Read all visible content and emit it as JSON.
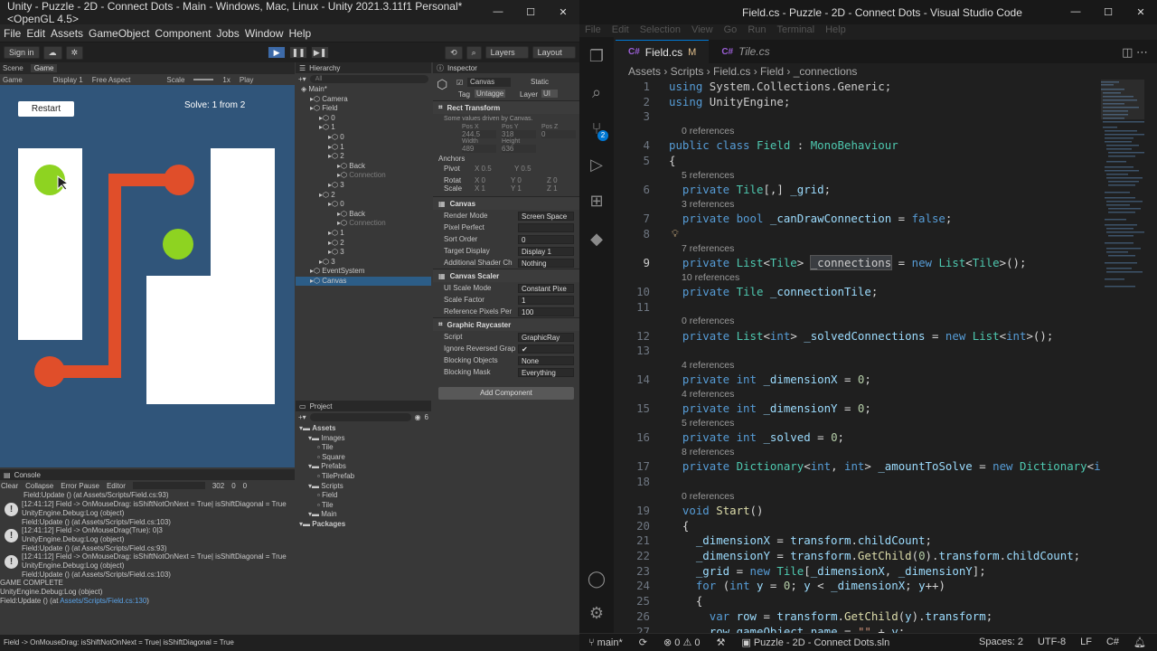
{
  "unity": {
    "title": "Unity - Puzzle - 2D - Connect Dots - Main - Windows, Mac, Linux - Unity 2021.3.11f1 Personal* <OpenGL 4.5>",
    "menu": [
      "File",
      "Edit",
      "Assets",
      "GameObject",
      "Component",
      "Jobs",
      "Window",
      "Help"
    ],
    "toolbar": {
      "sign_in": "Sign in",
      "layers": "Layers",
      "layout": "Layout"
    },
    "game_tabs": {
      "scene": "Scene",
      "game": "Game"
    },
    "game_bar": {
      "mode": "Game",
      "display": "Display 1",
      "aspect": "Free Aspect",
      "scale_label": "Scale",
      "scale_value": "1x",
      "play_label": "Play"
    },
    "game": {
      "restart": "Restart",
      "solve_text": "Solve: 1 from 2",
      "colors": {
        "bg": "#30557a",
        "white": "#ffffff",
        "line": "#e04e2a",
        "green": "#8ed321"
      }
    },
    "hierarchy": {
      "title": "Hierarchy",
      "search_placeholder": "All",
      "items": [
        {
          "label": "Main*",
          "depth": 0
        },
        {
          "label": "Camera",
          "depth": 1
        },
        {
          "label": "Field",
          "depth": 1
        },
        {
          "label": "0",
          "depth": 2
        },
        {
          "label": "1",
          "depth": 2
        },
        {
          "label": "0",
          "depth": 3
        },
        {
          "label": "1",
          "depth": 3
        },
        {
          "label": "2",
          "depth": 3
        },
        {
          "label": "Back",
          "depth": 4
        },
        {
          "label": "Connection",
          "depth": 4,
          "dim": true
        },
        {
          "label": "3",
          "depth": 3
        },
        {
          "label": "2",
          "depth": 2
        },
        {
          "label": "0",
          "depth": 3
        },
        {
          "label": "Back",
          "depth": 4
        },
        {
          "label": "Connection",
          "depth": 4,
          "dim": true
        },
        {
          "label": "1",
          "depth": 3
        },
        {
          "label": "2",
          "depth": 3
        },
        {
          "label": "3",
          "depth": 3
        },
        {
          "label": "3",
          "depth": 2
        },
        {
          "label": "EventSystem",
          "depth": 1
        },
        {
          "label": "Canvas",
          "depth": 1,
          "selected": true
        }
      ]
    },
    "inspector": {
      "title": "Inspector",
      "object_name": "Canvas",
      "static_label": "Static",
      "tag_label": "Tag",
      "tag_value": "Untagge",
      "layer_label": "Layer",
      "layer_value": "UI",
      "rect_transform": {
        "title": "Rect Transform",
        "note": "Some values driven by Canvas.",
        "posx_label": "Pos X",
        "posy_label": "Pos Y",
        "posz_label": "Pos Z",
        "posx": "244.5",
        "posy": "318",
        "posz": "0",
        "width_label": "Width",
        "height_label": "Height",
        "width": "489",
        "height": "636",
        "anchors": "Anchors",
        "pivot_label": "Pivot",
        "pivot_x": "X 0.5",
        "pivot_y": "Y 0.5",
        "rotat_label": "Rotat",
        "rot_x": "X 0",
        "rot_y": "Y 0",
        "rot_z": "Z 0",
        "scale_label": "Scale",
        "scale_x": "X 1",
        "scale_y": "Y 1",
        "scale_z": "Z 1"
      },
      "canvas": {
        "title": "Canvas",
        "rows": [
          [
            "Render Mode",
            "Screen Space"
          ],
          [
            "Pixel Perfect",
            ""
          ],
          [
            "Sort Order",
            "0"
          ],
          [
            "Target Display",
            "Display 1"
          ],
          [
            "Additional Shader Ch",
            "Nothing"
          ]
        ]
      },
      "canvas_scaler": {
        "title": "Canvas Scaler",
        "rows": [
          [
            "UI Scale Mode",
            "Constant Pixe"
          ],
          [
            "Scale Factor",
            "1"
          ],
          [
            "Reference Pixels Per",
            "100"
          ]
        ]
      },
      "raycaster": {
        "title": "Graphic Raycaster",
        "rows": [
          [
            "Script",
            "GraphicRay"
          ],
          [
            "Ignore Reversed Grap",
            "✔"
          ],
          [
            "Blocking Objects",
            "None"
          ],
          [
            "Blocking Mask",
            "Everything"
          ]
        ]
      },
      "add_component": "Add Component"
    },
    "project": {
      "title": "Project",
      "count": "6",
      "items": [
        {
          "label": "Assets",
          "depth": 0,
          "bold": true
        },
        {
          "label": "Images",
          "depth": 1
        },
        {
          "label": "Tile",
          "depth": 2
        },
        {
          "label": "Square",
          "depth": 2
        },
        {
          "label": "Prefabs",
          "depth": 1
        },
        {
          "label": "TilePrefab",
          "depth": 2
        },
        {
          "label": "Scripts",
          "depth": 1
        },
        {
          "label": "Field",
          "depth": 2
        },
        {
          "label": "Tile",
          "depth": 2
        },
        {
          "label": "Main",
          "depth": 1
        },
        {
          "label": "Packages",
          "depth": 0,
          "bold": true
        }
      ]
    },
    "console": {
      "title": "Console",
      "clear": "Clear",
      "collapse": "Collapse",
      "error_pause": "Error Pause",
      "editor": "Editor",
      "count_log": "302",
      "count_warn": "0",
      "count_err": "0",
      "top_line": "Field:Update () (at Assets/Scripts/Field.cs:93)",
      "entries": [
        [
          "[12:41:12] Field -> OnMouseDrag: isShiftNotOnNext = True| isShiftDiagonal = True",
          "UnityEngine.Debug:Log (object)",
          "Field:Update () (at Assets/Scripts/Field.cs:103)"
        ],
        [
          "[12:41:12] Field -> OnMouseDrag(True): 0|3",
          "UnityEngine.Debug:Log (object)",
          "Field:Update () (at Assets/Scripts/Field.cs:93)"
        ],
        [
          "[12:41:12] Field -> OnMouseDrag: isShiftNotOnNext = True| isShiftDiagonal = True",
          "UnityEngine.Debug:Log (object)",
          "Field:Update () (at Assets/Scripts/Field.cs:103)"
        ]
      ],
      "final": [
        "GAME COMPLETE",
        "UnityEngine.Debug:Log (object)",
        "Field:Update () (at ",
        "Assets/Scripts/Field.cs:130",
        ")"
      ],
      "status": "Field -> OnMouseDrag: isShiftNotOnNext = True| isShiftDiagonal = True"
    }
  },
  "vscode": {
    "title": "Field.cs - Puzzle - 2D - Connect Dots - Visual Studio Code",
    "menu": [
      "File",
      "Edit",
      "Selection",
      "View",
      "Go",
      "Run",
      "Terminal",
      "Help"
    ],
    "tabs": [
      {
        "label": "Field.cs",
        "mark": "M"
      },
      {
        "label": "Tile.cs"
      }
    ],
    "breadcrumb": "Assets › Scripts › Field.cs › Field › _connections",
    "scm_badge": "2",
    "status": {
      "branch": "main*",
      "errors": "0",
      "warnings": "0",
      "solution": "Puzzle - 2D - Connect Dots.sln",
      "spaces": "Spaces: 2",
      "encoding": "UTF-8",
      "eol": "LF",
      "lang": "C#"
    },
    "lines": [
      {
        "n": "1",
        "t": [
          [
            "kw",
            "using"
          ],
          [
            "pl",
            " System.Collections.Generic;"
          ]
        ]
      },
      {
        "n": "2",
        "t": [
          [
            "kw",
            "using"
          ],
          [
            "pl",
            " UnityEngine;"
          ]
        ]
      },
      {
        "n": "3",
        "t": []
      },
      {
        "lens": "0 references"
      },
      {
        "n": "4",
        "t": [
          [
            "kw",
            "public class "
          ],
          [
            "ty",
            "Field"
          ],
          [
            "pl",
            " : "
          ],
          [
            "ty",
            "MonoBehaviour"
          ]
        ]
      },
      {
        "n": "5",
        "t": [
          [
            "pu",
            "{"
          ]
        ]
      },
      {
        "lens": "5 references"
      },
      {
        "n": "6",
        "t": [
          [
            "pl",
            "  "
          ],
          [
            "kw",
            "private "
          ],
          [
            "ty",
            "Tile"
          ],
          [
            "pu",
            "[,] "
          ],
          [
            "vr",
            "_grid"
          ],
          [
            "pu",
            ";"
          ]
        ]
      },
      {
        "lens": "3 references"
      },
      {
        "n": "7",
        "t": [
          [
            "pl",
            "  "
          ],
          [
            "kw",
            "private bool "
          ],
          [
            "vr",
            "_canDrawConnection"
          ],
          [
            "pu",
            " = "
          ],
          [
            "kw",
            "false"
          ],
          [
            "pu",
            ";"
          ]
        ]
      },
      {
        "n": "8",
        "t": []
      },
      {
        "lens": "7 references"
      },
      {
        "n": "9",
        "cur": true,
        "t": [
          [
            "pl",
            "  "
          ],
          [
            "kw",
            "private "
          ],
          [
            "ty",
            "List"
          ],
          [
            "pu",
            "<"
          ],
          [
            "ty",
            "Tile"
          ],
          [
            "pu",
            "> "
          ],
          [
            "hl",
            "_connections"
          ],
          [
            "pu",
            " = "
          ],
          [
            "kw",
            "new "
          ],
          [
            "ty",
            "List"
          ],
          [
            "pu",
            "<"
          ],
          [
            "ty",
            "Tile"
          ],
          [
            "pu",
            ">();"
          ]
        ]
      },
      {
        "lens": "10 references"
      },
      {
        "n": "10",
        "t": [
          [
            "pl",
            "  "
          ],
          [
            "kw",
            "private "
          ],
          [
            "ty",
            "Tile"
          ],
          [
            "vr",
            " _connectionTile"
          ],
          [
            "pu",
            ";"
          ]
        ]
      },
      {
        "n": "11",
        "t": []
      },
      {
        "lens": "0 references"
      },
      {
        "n": "12",
        "t": [
          [
            "pl",
            "  "
          ],
          [
            "kw",
            "private "
          ],
          [
            "ty",
            "List"
          ],
          [
            "pu",
            "<"
          ],
          [
            "kw",
            "int"
          ],
          [
            "pu",
            "> "
          ],
          [
            "vr",
            "_solvedConnections"
          ],
          [
            "pu",
            " = "
          ],
          [
            "kw",
            "new "
          ],
          [
            "ty",
            "List"
          ],
          [
            "pu",
            "<"
          ],
          [
            "kw",
            "int"
          ],
          [
            "pu",
            ">();"
          ]
        ]
      },
      {
        "n": "13",
        "t": []
      },
      {
        "lens": "4 references"
      },
      {
        "n": "14",
        "t": [
          [
            "pl",
            "  "
          ],
          [
            "kw",
            "private int "
          ],
          [
            "vr",
            "_dimensionX"
          ],
          [
            "pu",
            " = "
          ],
          [
            "nm",
            "0"
          ],
          [
            "pu",
            ";"
          ]
        ]
      },
      {
        "lens": "4 references"
      },
      {
        "n": "15",
        "t": [
          [
            "pl",
            "  "
          ],
          [
            "kw",
            "private int "
          ],
          [
            "vr",
            "_dimensionY"
          ],
          [
            "pu",
            " = "
          ],
          [
            "nm",
            "0"
          ],
          [
            "pu",
            ";"
          ]
        ]
      },
      {
        "lens": "5 references"
      },
      {
        "n": "16",
        "t": [
          [
            "pl",
            "  "
          ],
          [
            "kw",
            "private int "
          ],
          [
            "vr",
            "_solved"
          ],
          [
            "pu",
            " = "
          ],
          [
            "nm",
            "0"
          ],
          [
            "pu",
            ";"
          ]
        ]
      },
      {
        "lens": "8 references"
      },
      {
        "n": "17",
        "t": [
          [
            "pl",
            "  "
          ],
          [
            "kw",
            "private "
          ],
          [
            "ty",
            "Dictionary"
          ],
          [
            "pu",
            "<"
          ],
          [
            "kw",
            "int"
          ],
          [
            "pu",
            ", "
          ],
          [
            "kw",
            "int"
          ],
          [
            "pu",
            "> "
          ],
          [
            "vr",
            "_amountToSolve"
          ],
          [
            "pu",
            " = "
          ],
          [
            "kw",
            "new "
          ],
          [
            "ty",
            "Dictionary"
          ],
          [
            "pu",
            "<"
          ],
          [
            "kw",
            "int"
          ],
          [
            "pu",
            ","
          ]
        ]
      },
      {
        "n": "18",
        "t": []
      },
      {
        "lens": "0 references"
      },
      {
        "n": "19",
        "t": [
          [
            "pl",
            "  "
          ],
          [
            "kw",
            "void "
          ],
          [
            "fn",
            "Start"
          ],
          [
            "pu",
            "()"
          ]
        ]
      },
      {
        "n": "20",
        "t": [
          [
            "pl",
            "  "
          ],
          [
            "pu",
            "{"
          ]
        ]
      },
      {
        "n": "21",
        "t": [
          [
            "pl",
            "    "
          ],
          [
            "vr",
            "_dimensionX"
          ],
          [
            "pu",
            " = "
          ],
          [
            "vr",
            "transform"
          ],
          [
            "pu",
            "."
          ],
          [
            "vr",
            "childCount"
          ],
          [
            "pu",
            ";"
          ]
        ]
      },
      {
        "n": "22",
        "t": [
          [
            "pl",
            "    "
          ],
          [
            "vr",
            "_dimensionY"
          ],
          [
            "pu",
            " = "
          ],
          [
            "vr",
            "transform"
          ],
          [
            "pu",
            "."
          ],
          [
            "fn",
            "GetChild"
          ],
          [
            "pu",
            "("
          ],
          [
            "nm",
            "0"
          ],
          [
            "pu",
            ")."
          ],
          [
            "vr",
            "transform"
          ],
          [
            "pu",
            "."
          ],
          [
            "vr",
            "childCount"
          ],
          [
            "pu",
            ";"
          ]
        ]
      },
      {
        "n": "23",
        "t": [
          [
            "pl",
            "    "
          ],
          [
            "vr",
            "_grid"
          ],
          [
            "pu",
            " = "
          ],
          [
            "kw",
            "new "
          ],
          [
            "ty",
            "Tile"
          ],
          [
            "pu",
            "["
          ],
          [
            "vr",
            "_dimensionX"
          ],
          [
            "pu",
            ", "
          ],
          [
            "vr",
            "_dimensionY"
          ],
          [
            "pu",
            "];"
          ]
        ]
      },
      {
        "n": "24",
        "t": [
          [
            "pl",
            "    "
          ],
          [
            "kw",
            "for "
          ],
          [
            "pu",
            "("
          ],
          [
            "kw",
            "int "
          ],
          [
            "vr",
            "y"
          ],
          [
            "pu",
            " = "
          ],
          [
            "nm",
            "0"
          ],
          [
            "pu",
            "; "
          ],
          [
            "vr",
            "y"
          ],
          [
            "pu",
            " < "
          ],
          [
            "vr",
            "_dimensionX"
          ],
          [
            "pu",
            "; "
          ],
          [
            "vr",
            "y"
          ],
          [
            "pu",
            "++)"
          ]
        ]
      },
      {
        "n": "25",
        "t": [
          [
            "pl",
            "    "
          ],
          [
            "pu",
            "{"
          ]
        ]
      },
      {
        "n": "26",
        "t": [
          [
            "pl",
            "      "
          ],
          [
            "kw",
            "var "
          ],
          [
            "vr",
            "row"
          ],
          [
            "pu",
            " = "
          ],
          [
            "vr",
            "transform"
          ],
          [
            "pu",
            "."
          ],
          [
            "fn",
            "GetChild"
          ],
          [
            "pu",
            "("
          ],
          [
            "vr",
            "y"
          ],
          [
            "pu",
            ")."
          ],
          [
            "vr",
            "transform"
          ],
          [
            "pu",
            ";"
          ]
        ]
      },
      {
        "n": "27",
        "t": [
          [
            "pl",
            "      "
          ],
          [
            "vr",
            "row"
          ],
          [
            "pu",
            "."
          ],
          [
            "vr",
            "gameObject"
          ],
          [
            "pu",
            "."
          ],
          [
            "vr",
            "name"
          ],
          [
            "pu",
            " = "
          ],
          [
            "st",
            "\"\""
          ],
          [
            "pu",
            " + "
          ],
          [
            "vr",
            "y"
          ],
          [
            "pu",
            ";"
          ]
        ]
      }
    ]
  }
}
